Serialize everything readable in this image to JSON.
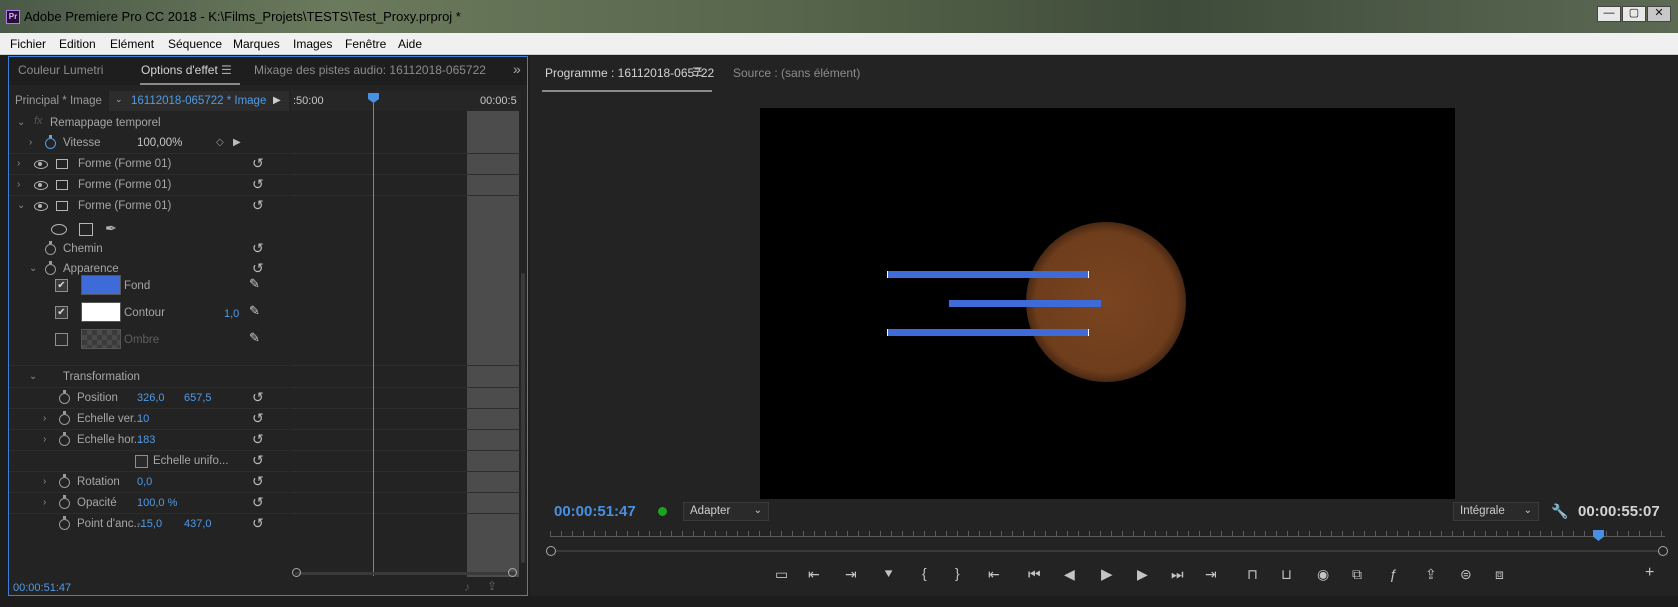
{
  "window": {
    "app_logo": "Pr",
    "title": "Adobe Premiere Pro CC 2018 - K:\\Films_Projets\\TESTS\\Test_Proxy.prproj *",
    "minimize": "—",
    "maximize": "▢",
    "close": "✕"
  },
  "menu": [
    "Fichier",
    "Edition",
    "Elément",
    "Séquence",
    "Marques",
    "Images",
    "Fenêtre",
    "Aide"
  ],
  "left_panel": {
    "tabs": [
      "Couleur Lumetri",
      "Options d'effet",
      "Mixage des pistes audio: 16112018-065722"
    ],
    "active_tab": "Options d'effet",
    "more": "»",
    "master_clip": "Principal * Image",
    "sequence_clip": "16112018-065722 * Image",
    "ruler_start": ":50:00",
    "ruler_end": "00:00:5",
    "fx_label": "fx",
    "effects": {
      "time_remap": "Remappage temporel",
      "speed_label": "Vitesse",
      "speed_value": "100,00%",
      "shapes": [
        "Forme (Forme 01)",
        "Forme (Forme 01)",
        "Forme (Forme 01)"
      ],
      "path": "Chemin",
      "appearance": "Apparence",
      "fill": "Fond",
      "fill_color": "#3f6bd8",
      "stroke": "Contour",
      "stroke_color": "#ffffff",
      "stroke_width": "1,0",
      "shadow": "Ombre",
      "transform": "Transformation",
      "position_label": "Position",
      "position_x": "326,0",
      "position_y": "657,5",
      "scale_v_label": "Echelle ver...",
      "scale_v": "10",
      "scale_h_label": "Echelle hor...",
      "scale_h": "183",
      "uniform_scale": "Echelle unifo...",
      "rotation_label": "Rotation",
      "rotation": "0,0",
      "opacity_label": "Opacité",
      "opacity": "100,0 %",
      "anchor_label": "Point d'anc...",
      "anchor_x": "-15,0",
      "anchor_y": "437,0"
    },
    "timecode": "00:00:51:47"
  },
  "program": {
    "tab_program": "Programme : 16112018-065722",
    "tab_source": "Source : (sans élément)",
    "current_tc": "00:00:51:47",
    "fit": "Adapter",
    "quality": "Intégrale",
    "duration_tc": "00:00:55:07",
    "add": "+",
    "colors": {
      "accent": "#4a90e2",
      "bars": "#3f6bd8",
      "circle": "#7a4420"
    }
  }
}
